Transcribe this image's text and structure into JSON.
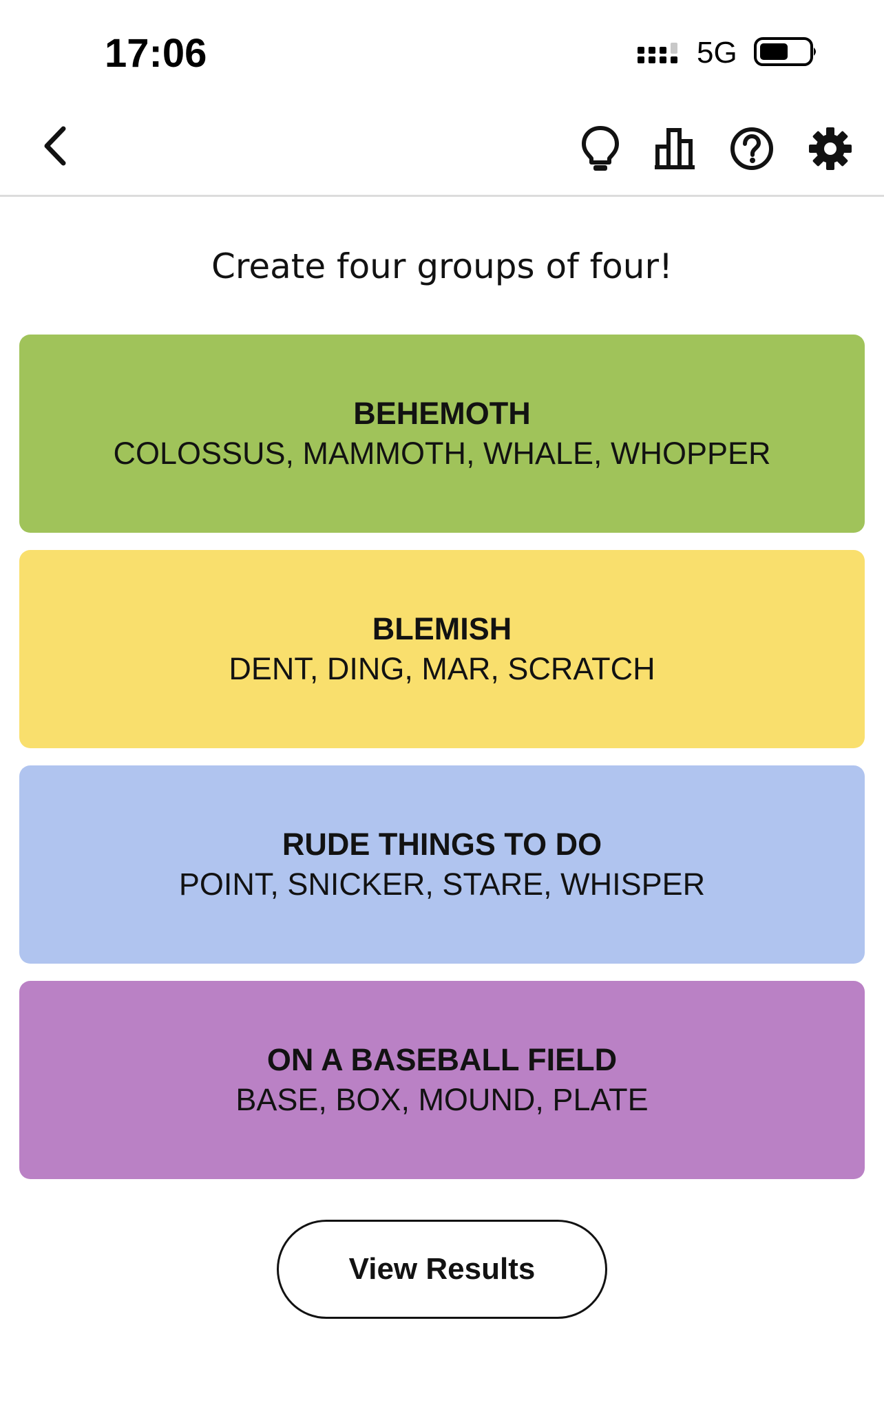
{
  "status_bar": {
    "time": "17:06",
    "network": "5G",
    "icons": [
      "cellular-signal-icon",
      "battery-icon"
    ]
  },
  "toolbar": {
    "icons": [
      "back-chevron-icon",
      "lightbulb-icon",
      "bar-chart-icon",
      "question-circle-icon",
      "gear-icon"
    ]
  },
  "main": {
    "instruction": "Create four groups of four!",
    "groups": [
      {
        "title": "BEHEMOTH",
        "members": "COLOSSUS, MAMMOTH, WHALE, WHOPPER",
        "color": "#a0c35a"
      },
      {
        "title": "BLEMISH",
        "members": "DENT, DING, MAR, SCRATCH",
        "color": "#f9df6d"
      },
      {
        "title": "RUDE THINGS TO DO",
        "members": "POINT, SNICKER, STARE, WHISPER",
        "color": "#b0c4ef"
      },
      {
        "title": "ON A BASEBALL FIELD",
        "members": "BASE, BOX, MOUND, PLATE",
        "color": "#ba81c5"
      }
    ],
    "view_results_label": "View Results"
  }
}
